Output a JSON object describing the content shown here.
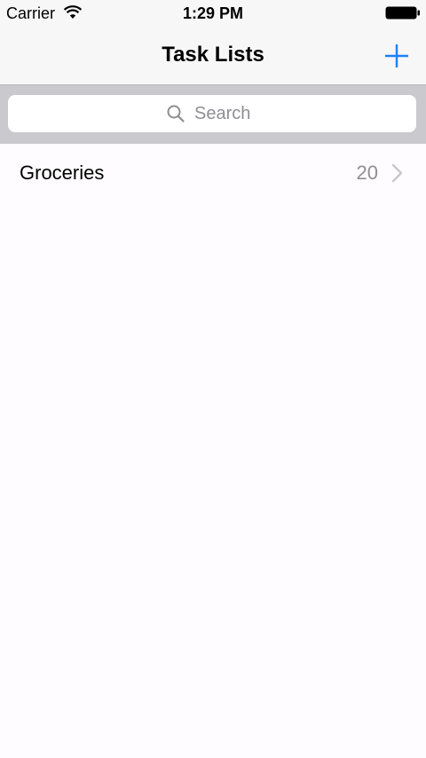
{
  "status_bar": {
    "carrier": "Carrier",
    "time": "1:29 PM",
    "wifi_icon": "wifi-icon",
    "battery_icon": "battery-icon"
  },
  "nav": {
    "title": "Task Lists",
    "add_icon": "plus-icon",
    "accent_color": "#1a82fb"
  },
  "search": {
    "placeholder": "Search",
    "icon": "search-icon"
  },
  "task_lists": [
    {
      "name": "Groceries",
      "count": "20"
    }
  ]
}
